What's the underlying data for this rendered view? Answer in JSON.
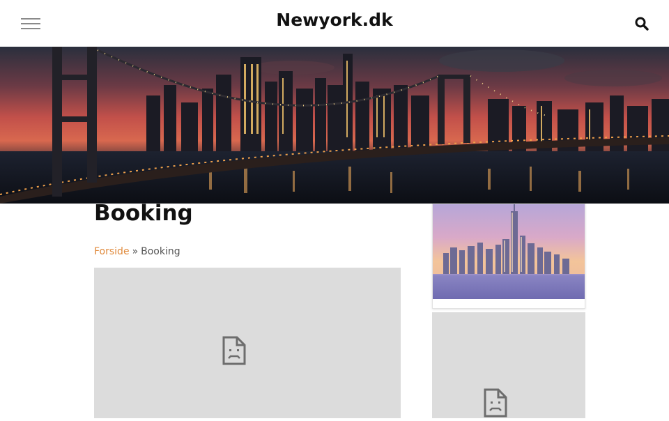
{
  "header": {
    "site_title": "Newyork.dk",
    "menu_icon": "hamburger-menu-icon",
    "search_icon": "search-icon"
  },
  "hero": {
    "image": "new-york-bridge-skyline-at-dusk"
  },
  "main": {
    "page_title": "Booking",
    "breadcrumb": {
      "home_label": "Forside",
      "separator": "»",
      "current_label": "Booking"
    },
    "embed_status_icon": "broken-document-icon"
  },
  "sidebar": {
    "card_image": "manhattan-skyline-photo",
    "embed_status_icon": "broken-document-icon"
  },
  "colors": {
    "link": "#e08a3c",
    "embed_background": "#dcdcdc",
    "title_text": "#111111"
  }
}
